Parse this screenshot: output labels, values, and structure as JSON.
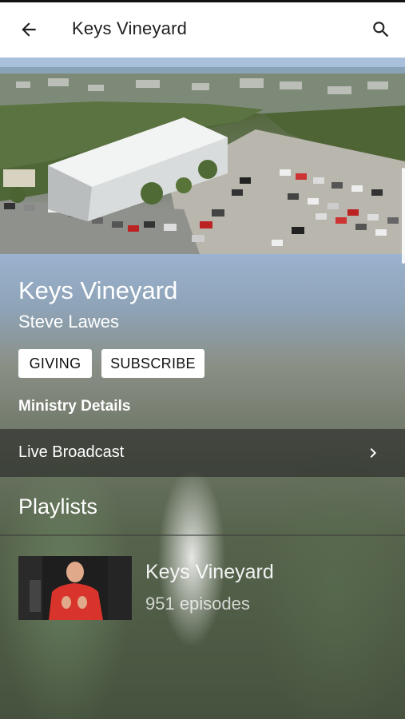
{
  "appbar": {
    "title": "Keys Vineyard",
    "back_icon": "arrow-left-icon",
    "search_icon": "search-icon"
  },
  "channel": {
    "name": "Keys Vineyard",
    "author": "Steve Lawes"
  },
  "actions": {
    "giving_label": "GIVING",
    "subscribe_label": "SUBSCRIBE"
  },
  "ministry_details": {
    "heading": "Ministry Details",
    "items": [
      {
        "label": "Live Broadcast",
        "icon": "chevron-right-icon"
      }
    ]
  },
  "playlists": {
    "heading": "Playlists",
    "items": [
      {
        "title": "Keys Vineyard",
        "episodes": "951 episodes"
      }
    ]
  },
  "colors": {
    "appbar_bg": "#ffffff",
    "button_bg": "#ffffff",
    "text_light": "#ffffff"
  }
}
